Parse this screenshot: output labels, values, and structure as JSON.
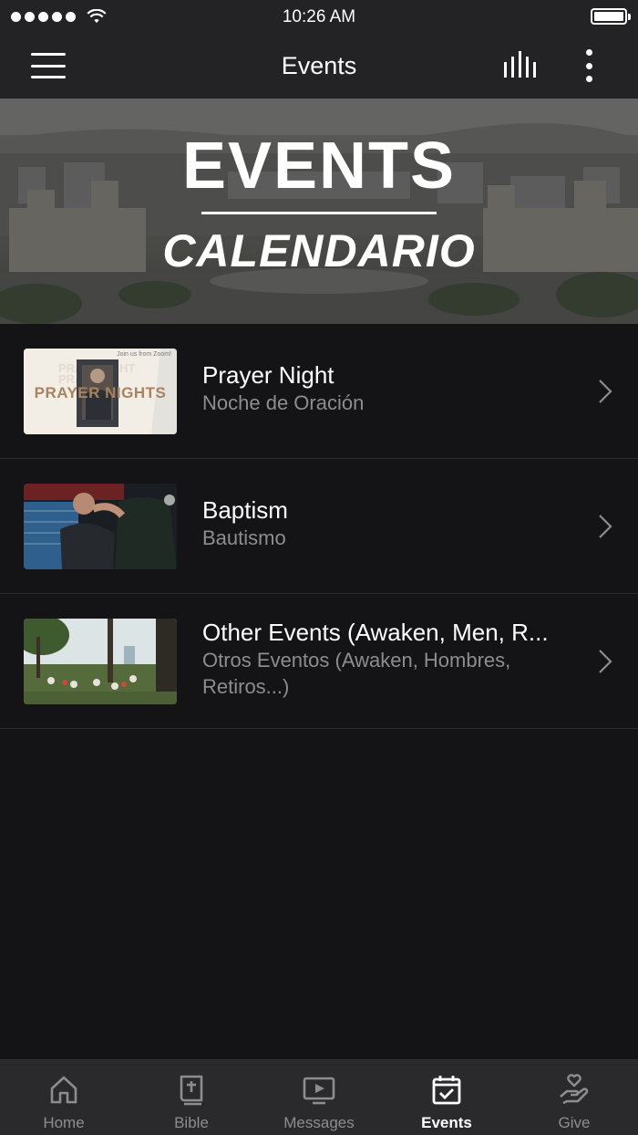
{
  "status_bar": {
    "time": "10:26 AM"
  },
  "nav": {
    "title": "Events"
  },
  "hero": {
    "title_top": "EVENTS",
    "title_bottom": "CALENDARIO"
  },
  "events": [
    {
      "title": "Prayer Night",
      "subtitle": "Noche de Oración",
      "thumb_text_main": "PRAYER NIGHTS",
      "thumb_text_corner": "Join us from Zoom!"
    },
    {
      "title": "Baptism",
      "subtitle": "Bautismo"
    },
    {
      "title": "Other Events (Awaken, Men, R...",
      "subtitle": "Otros Eventos (Awaken, Hombres, Retiros...)"
    }
  ],
  "tabs": [
    {
      "label": "Home",
      "icon": "home-icon",
      "active": false
    },
    {
      "label": "Bible",
      "icon": "bible-icon",
      "active": false
    },
    {
      "label": "Messages",
      "icon": "messages-icon",
      "active": false
    },
    {
      "label": "Events",
      "icon": "events-icon",
      "active": true
    },
    {
      "label": "Give",
      "icon": "give-icon",
      "active": false
    }
  ],
  "colors": {
    "background": "#141416",
    "bar_background": "#232325",
    "tab_bar_background": "#2a2a2c",
    "secondary_text": "#8d8d90",
    "active_tab": "#ffffff"
  }
}
